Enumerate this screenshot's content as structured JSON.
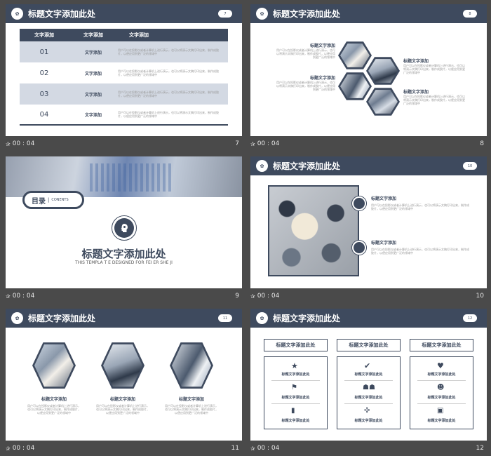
{
  "common": {
    "header_title": "标题文字添加此处",
    "logo_text": "✿",
    "footer_time": "00 : 04",
    "star": "✰",
    "tiny_text": "用户可以在投影仪或者计算机上进行演示，也可以将演示文稿打印出来，制作成胶片，以便应用到更广泛的领域中",
    "text_add": "文字添加"
  },
  "slides": [
    {
      "page": "7",
      "badge": "7",
      "table_headers": [
        "文字添加",
        "文字添加",
        "文字添加"
      ],
      "rows": [
        {
          "num": "01",
          "label": "文字添加"
        },
        {
          "num": "02",
          "label": "文字添加"
        },
        {
          "num": "03",
          "label": "文字添加"
        },
        {
          "num": "04",
          "label": "文字添加"
        }
      ]
    },
    {
      "page": "8",
      "badge": "8",
      "blocks": [
        {
          "title": "标题文字添加"
        },
        {
          "title": "标题文字添加"
        },
        {
          "title": "标题文字添加"
        },
        {
          "title": "标题文字添加"
        }
      ]
    },
    {
      "page": "9",
      "toc_label": "目录",
      "toc_sub": "CONENTS",
      "title": "标题文字添加此处",
      "subtitle": "THIS TEMPLA T E DESIGNED FOR FEI ER SHE JI"
    },
    {
      "page": "10",
      "badge": "10",
      "items": [
        {
          "title": "标题文字添加"
        },
        {
          "title": "标题文字添加"
        }
      ]
    },
    {
      "page": "11",
      "badge": "11",
      "items": [
        {
          "title": "标题文字添加"
        },
        {
          "title": "标题文字添加"
        },
        {
          "title": "标题文字添加"
        }
      ]
    },
    {
      "page": "12",
      "badge": "12",
      "columns": [
        {
          "header": "标题文字添加此处",
          "items": [
            "标题文字添加此处",
            "标题文字添加此处",
            "标题文字添加此处"
          ],
          "icons": [
            "star-icon",
            "person-rocket-icon",
            "bar-chart-icon"
          ]
        },
        {
          "header": "标题文字添加此处",
          "items": [
            "标题文字添加此处",
            "标题文字添加此处",
            "标题文字添加此处"
          ],
          "icons": [
            "check-icon",
            "team-icon",
            "network-icon"
          ]
        },
        {
          "header": "标题文字添加此处",
          "items": [
            "标题文字添加此处",
            "标题文字添加此处",
            "标题文字添加此处"
          ],
          "icons": [
            "heart-icon",
            "group-icon",
            "money-icon"
          ]
        }
      ]
    }
  ]
}
